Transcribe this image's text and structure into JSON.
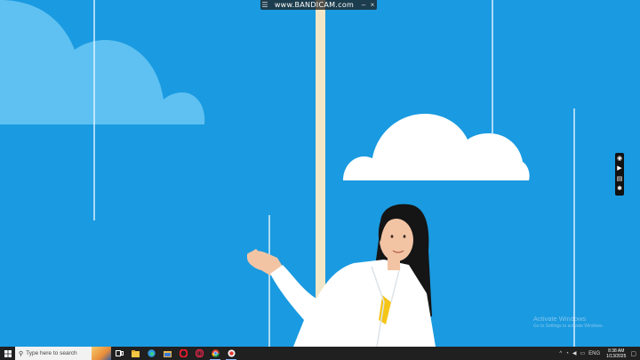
{
  "recorder": {
    "menu_icon": "hamburger-icon",
    "title": "www.BANDICAM.com",
    "watermark": "www.BANDICAM.com",
    "minimize": "–",
    "close": "×"
  },
  "side_toolbar": {
    "icons": [
      "camera-icon",
      "video-icon",
      "notes-icon",
      "settings-icon"
    ]
  },
  "activation": {
    "title": "Activate Windows",
    "subtitle": "Go to Settings to activate Windows."
  },
  "taskbar": {
    "search_placeholder": "Type here to search",
    "apps": [
      "task-view",
      "file-explorer",
      "edge",
      "file-manager",
      "opera",
      "opera-gx",
      "chrome",
      "recorder"
    ],
    "tray": {
      "chevron": "^",
      "language": "ENG",
      "time": "8:38 AM",
      "date": "1/13/2025"
    }
  },
  "colors": {
    "sky": "#1a9ae0",
    "cloud_light": "#5ec1f2",
    "cloud_white": "#ffffff",
    "pole": "#f1e6c8",
    "jacket": "#ffffff",
    "hair": "#151515",
    "skin": "#f3c4a4",
    "shirt": "#f5c518",
    "taskbar": "#202020"
  }
}
